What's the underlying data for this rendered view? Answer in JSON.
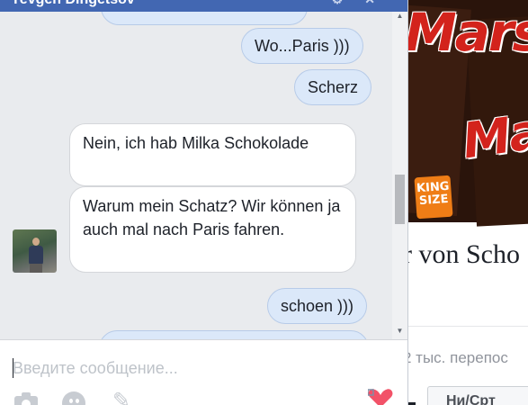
{
  "chat": {
    "contact_name": "Yevgen Dingetsov",
    "messages": [
      {
        "direction": "outgoing",
        "text": ""
      },
      {
        "direction": "outgoing",
        "text": "Wo...Paris )))"
      },
      {
        "direction": "outgoing",
        "text": "Scherz"
      },
      {
        "direction": "incoming",
        "text": "Nein, ich hab Milka Schokolade"
      },
      {
        "direction": "incoming",
        "text": "Warum mein Schatz? Wir können ja auch mal nach Paris fahren."
      },
      {
        "direction": "outgoing",
        "text": "schoen )))"
      },
      {
        "direction": "outgoing",
        "text": ""
      }
    ]
  },
  "composer": {
    "placeholder": "Введите сообщение...",
    "icons": [
      "camera-icon",
      "smile-icon",
      "paperclip-icon",
      "heart-sticker-icon"
    ]
  },
  "background_page": {
    "image_brand": "Mars",
    "image_badge": "KING SIZE",
    "title_fragment": "r von Scho",
    "stats_fragment": "2 тыс. перепос",
    "button_fragment": "Ни/Срт"
  },
  "colors": {
    "header_blue": "#4267b2",
    "outgoing_bubble": "#dbe8f9",
    "incoming_bubble": "#ffffff",
    "chat_background": "#e9ebee"
  }
}
